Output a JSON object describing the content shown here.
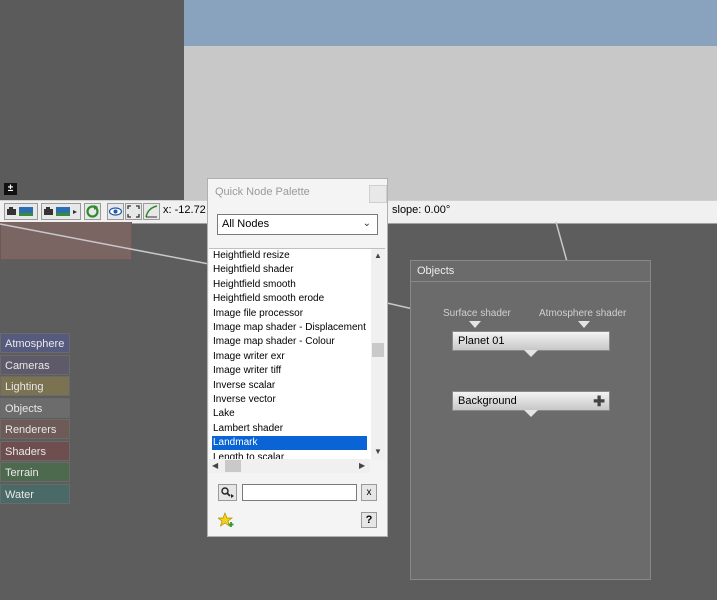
{
  "toolbar": {
    "coord_x": "x: -12.72 m",
    "slope": "slope: 0.00°"
  },
  "categories": [
    {
      "label": "Atmosphere",
      "color": "#565a7c"
    },
    {
      "label": "Cameras",
      "color": "#5e5a6a"
    },
    {
      "label": "Lighting",
      "color": "#7a7250"
    },
    {
      "label": "Objects",
      "color": "#6c6c6c"
    },
    {
      "label": "Renderers",
      "color": "#6e5a56"
    },
    {
      "label": "Shaders",
      "color": "#6e4e4e"
    },
    {
      "label": "Terrain",
      "color": "#4e6a4e"
    },
    {
      "label": "Water",
      "color": "#4a6a68"
    }
  ],
  "palette": {
    "title": "Quick Node Palette",
    "filter_value": "All Nodes",
    "items": [
      "Heightfield resize",
      "Heightfield shader",
      "Heightfield smooth",
      "Heightfield smooth erode",
      "Image file processor",
      "Image map shader - Displacement",
      "Image map shader - Colour",
      "Image writer exr",
      "Image writer tiff",
      "Inverse scalar",
      "Inverse vector",
      "Lake",
      "Lambert shader",
      "Landmark",
      "Length to scalar"
    ],
    "selected_index": 13,
    "search_value": "",
    "clear_label": "x",
    "help_label": "?"
  },
  "objects": {
    "title": "Objects",
    "input_surface": "Surface shader",
    "input_atmosphere": "Atmosphere shader",
    "node_planet": "Planet 01",
    "node_background": "Background"
  }
}
